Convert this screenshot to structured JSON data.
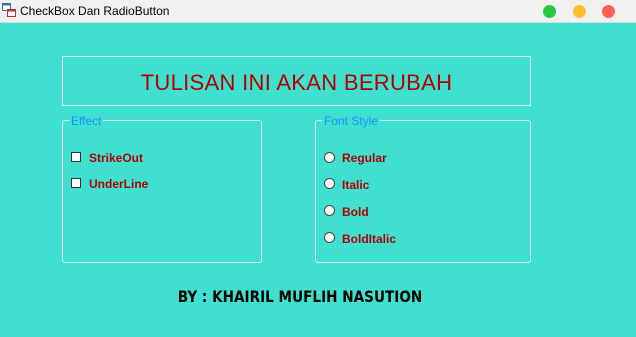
{
  "window": {
    "title": "CheckBox Dan RadioButton",
    "icon": "form-window-icon",
    "controls": [
      {
        "name": "maximize-button",
        "color": "#28c840"
      },
      {
        "name": "minimize-button",
        "color": "#febc2e"
      },
      {
        "name": "close-button",
        "color": "#ff5f57"
      }
    ]
  },
  "headline": {
    "text": "TULISAN INI AKAN BERUBAH"
  },
  "effect_group": {
    "legend": "Effect",
    "options": [
      {
        "label": "StrikeOut",
        "checked": false
      },
      {
        "label": "UnderLine",
        "checked": false
      }
    ]
  },
  "font_group": {
    "legend": "Font Style",
    "options": [
      {
        "label": "Regular",
        "selected": false
      },
      {
        "label": "Italic",
        "selected": false
      },
      {
        "label": "Bold",
        "selected": false
      },
      {
        "label": "BoldItalic",
        "selected": false
      }
    ]
  },
  "footer": {
    "text": "BY : KHAIRIL MUFLIH NASUTION"
  },
  "colors": {
    "background": "#40e0d0",
    "headline_text": "#b30000",
    "legend_text": "#1e90ff",
    "option_text": "#b30000"
  }
}
